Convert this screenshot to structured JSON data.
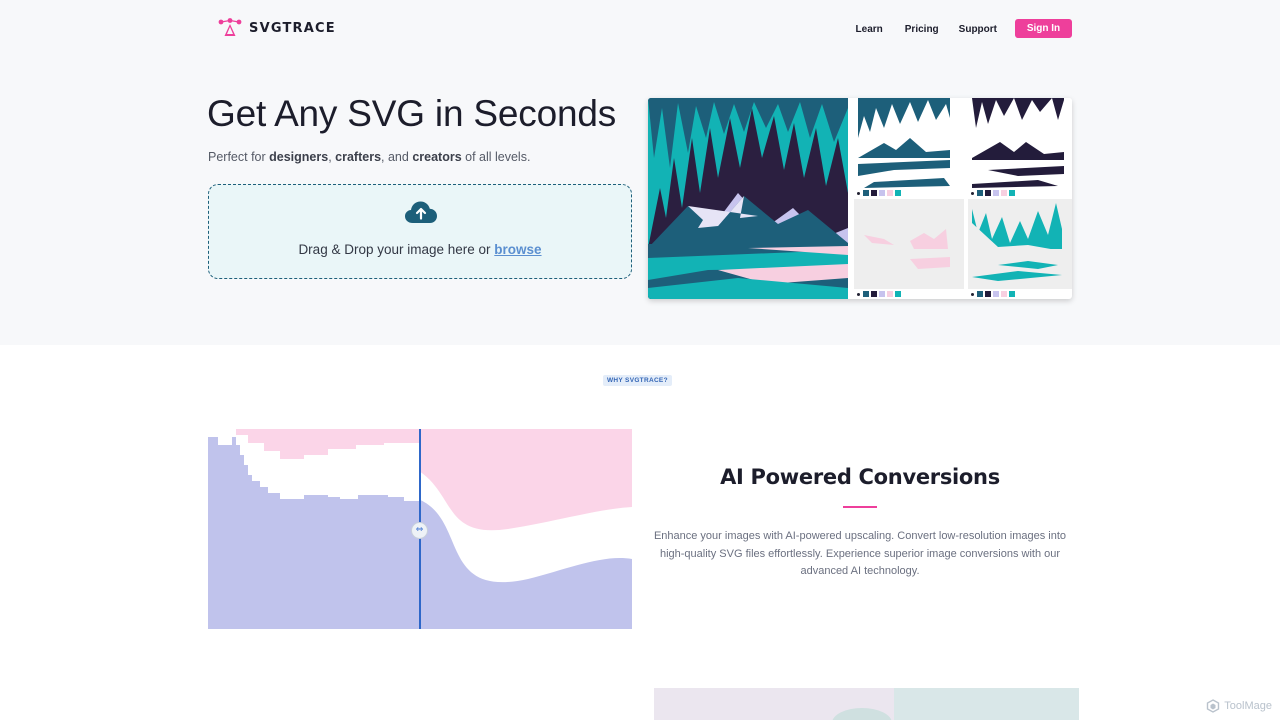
{
  "nav": {
    "logo_text": "SVGTRACE",
    "links": [
      "Learn",
      "Pricing",
      "Support"
    ],
    "signin_label": "Sign In"
  },
  "hero": {
    "title": "Get Any SVG in Seconds",
    "subtitle_prefix": "Perfect for ",
    "subtitle_b1": "designers",
    "subtitle_sep1": ", ",
    "subtitle_b2": "crafters",
    "subtitle_sep2": ", and ",
    "subtitle_b3": "creators",
    "subtitle_suffix": " of all levels.",
    "dropzone_text": "Drag & Drop your image here or ",
    "dropzone_link": "browse"
  },
  "collage": {
    "palette": [
      "#1d5f7a",
      "#231c3b",
      "#c7c3ee",
      "#f7cfe0",
      "#12b3b5"
    ]
  },
  "why": {
    "badge": "WHY SVGTRACE?",
    "feature_title": "AI Powered Conversions",
    "feature_desc": "Enhance your images with AI-powered upscaling. Convert low-resolution images into high-quality SVG files effortlessly. Experience superior image conversions with our advanced AI technology.",
    "compare_handle": "⇔"
  },
  "watermark": "ToolMage",
  "colors": {
    "accent_pink": "#ee3f9b",
    "dropzone_border": "#1d5f7a",
    "badge_blue": "#3466b6"
  }
}
